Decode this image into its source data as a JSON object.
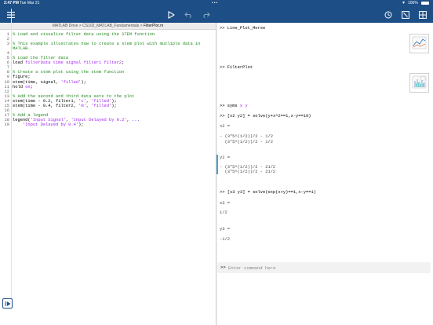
{
  "status_bar": {
    "time": "2:47 PM",
    "date": "Tue Mar 21",
    "dots": "•••",
    "battery_percent": "100%"
  },
  "toolbar": {
    "icons": [
      "menu-icon",
      "run-icon",
      "undo-icon",
      "redo-icon",
      "clock-icon",
      "clear-icon",
      "layout-icon"
    ],
    "accent": "#1d4f86"
  },
  "editor": {
    "breadcrumb": {
      "path": "MATLAB Drive > CS102_MATLAB_Fundamentals > ",
      "file": "FilterPlot.m"
    },
    "lines": [
      {
        "num": "1",
        "parts": [
          {
            "t": "% Load and visualize filter data using the STEM function",
            "c": "comment"
          }
        ]
      },
      {
        "num": "2",
        "parts": []
      },
      {
        "num": "3",
        "parts": [
          {
            "t": "% This example illustrates how to create a stem plot with mutliple data in",
            "c": "comment"
          }
        ]
      },
      {
        "num": "",
        "parts": [
          {
            "t": "MATLAB.",
            "c": "comment"
          }
        ]
      },
      {
        "num": "4",
        "parts": []
      },
      {
        "num": "5",
        "parts": [
          {
            "t": "% Load the filter data",
            "c": "comment"
          }
        ]
      },
      {
        "num": "6",
        "parts": [
          {
            "t": "load ",
            "c": "plain"
          },
          {
            "t": "filterData time signal filter1 filter2",
            "c": "string"
          },
          {
            "t": ";",
            "c": "plain"
          }
        ]
      },
      {
        "num": "7",
        "parts": []
      },
      {
        "num": "8",
        "parts": [
          {
            "t": "% Create a stem plot using the stem function",
            "c": "comment"
          }
        ]
      },
      {
        "num": "9",
        "parts": [
          {
            "t": "figure;",
            "c": "plain"
          }
        ]
      },
      {
        "num": "10",
        "parts": [
          {
            "t": "stem(time, signal, ",
            "c": "plain"
          },
          {
            "t": "'filled'",
            "c": "string"
          },
          {
            "t": ");",
            "c": "plain"
          }
        ]
      },
      {
        "num": "11",
        "parts": [
          {
            "t": "hold ",
            "c": "plain"
          },
          {
            "t": "on",
            "c": "string"
          },
          {
            "t": ";",
            "c": "plain"
          }
        ]
      },
      {
        "num": "12",
        "parts": []
      },
      {
        "num": "13",
        "parts": [
          {
            "t": "% Add the second and third data sets to the plot",
            "c": "comment"
          }
        ]
      },
      {
        "num": "14",
        "parts": [
          {
            "t": "stem(time - 0.2, filter1, ",
            "c": "plain"
          },
          {
            "t": "'c'",
            "c": "string"
          },
          {
            "t": ", ",
            "c": "plain"
          },
          {
            "t": "'filled'",
            "c": "string"
          },
          {
            "t": ");",
            "c": "plain"
          }
        ]
      },
      {
        "num": "15",
        "parts": [
          {
            "t": "stem(time - 0.4, filter2, ",
            "c": "plain"
          },
          {
            "t": "'m'",
            "c": "string"
          },
          {
            "t": ", ",
            "c": "plain"
          },
          {
            "t": "'filled'",
            "c": "string"
          },
          {
            "t": ");",
            "c": "plain"
          }
        ]
      },
      {
        "num": "16",
        "parts": []
      },
      {
        "num": "17",
        "parts": [
          {
            "t": "% Add a legend",
            "c": "comment"
          }
        ]
      },
      {
        "num": "18",
        "parts": [
          {
            "t": "legend(",
            "c": "plain"
          },
          {
            "t": "'Input Signal'",
            "c": "string"
          },
          {
            "t": ", ",
            "c": "plain"
          },
          {
            "t": "'Input Delayed by 0.2'",
            "c": "string"
          },
          {
            "t": ", ",
            "c": "plain"
          },
          {
            "t": "...",
            "c": "keyword"
          }
        ]
      },
      {
        "num": "19",
        "parts": [
          {
            "t": "    ",
            "c": "plain"
          },
          {
            "t": "'Input Delayed by 0.4'",
            "c": "string"
          },
          {
            "t": ");",
            "c": "plain"
          }
        ]
      }
    ]
  },
  "command_window": {
    "entries": [
      {
        "id": "cmd-line-plot-morse",
        "prompt": ">> ",
        "text": "Line_Plot_Morse",
        "style": "plain"
      },
      {
        "id": "cmd-filterplot",
        "prompt": ">> ",
        "text": "FilterPlot",
        "style": "plain"
      },
      {
        "id": "cmd-syms",
        "prompt": ">> ",
        "text": "syms ",
        "extra": "x y",
        "style": "plain"
      },
      {
        "id": "cmd-solve1",
        "prompt": ">> ",
        "text": "[x2 y2] = solve(y+x^2==1,x-y==10)",
        "style": "plain"
      },
      {
        "id": "out-x2-label",
        "prompt": "",
        "text": "x2 =",
        "style": "out"
      },
      {
        "id": "out-x2-v1",
        "prompt": "",
        "text": "- (3*5^(1/2))/2 - 1/2",
        "style": "out"
      },
      {
        "id": "out-x2-v2",
        "prompt": "",
        "text": "  (3*5^(1/2))/2 - 1/2",
        "style": "out"
      },
      {
        "id": "out-y2-label",
        "prompt": "",
        "text": "y2 =",
        "style": "out"
      },
      {
        "id": "out-y2-v1",
        "prompt": "",
        "text": "- (3*5^(1/2))/2 - 21/2",
        "style": "out"
      },
      {
        "id": "out-y2-v2",
        "prompt": "",
        "text": "  (3*5^(1/2))/2 - 21/2",
        "style": "out"
      },
      {
        "id": "cmd-solve2",
        "prompt": ">> ",
        "text": "[x3 y3] = solve(exp(x+y)==1,x-y==1)",
        "style": "plain"
      },
      {
        "id": "out-x3-label",
        "prompt": "",
        "text": "x3 =",
        "style": "out"
      },
      {
        "id": "out-x3-v",
        "prompt": "",
        "text": "1/2",
        "style": "out"
      },
      {
        "id": "out-y3-label",
        "prompt": "",
        "text": "y3 =",
        "style": "out"
      },
      {
        "id": "out-y3-v",
        "prompt": "",
        "text": "-1/2",
        "style": "out"
      }
    ],
    "input": {
      "prompt": ">>",
      "placeholder": "Enter command here",
      "value": ""
    }
  }
}
